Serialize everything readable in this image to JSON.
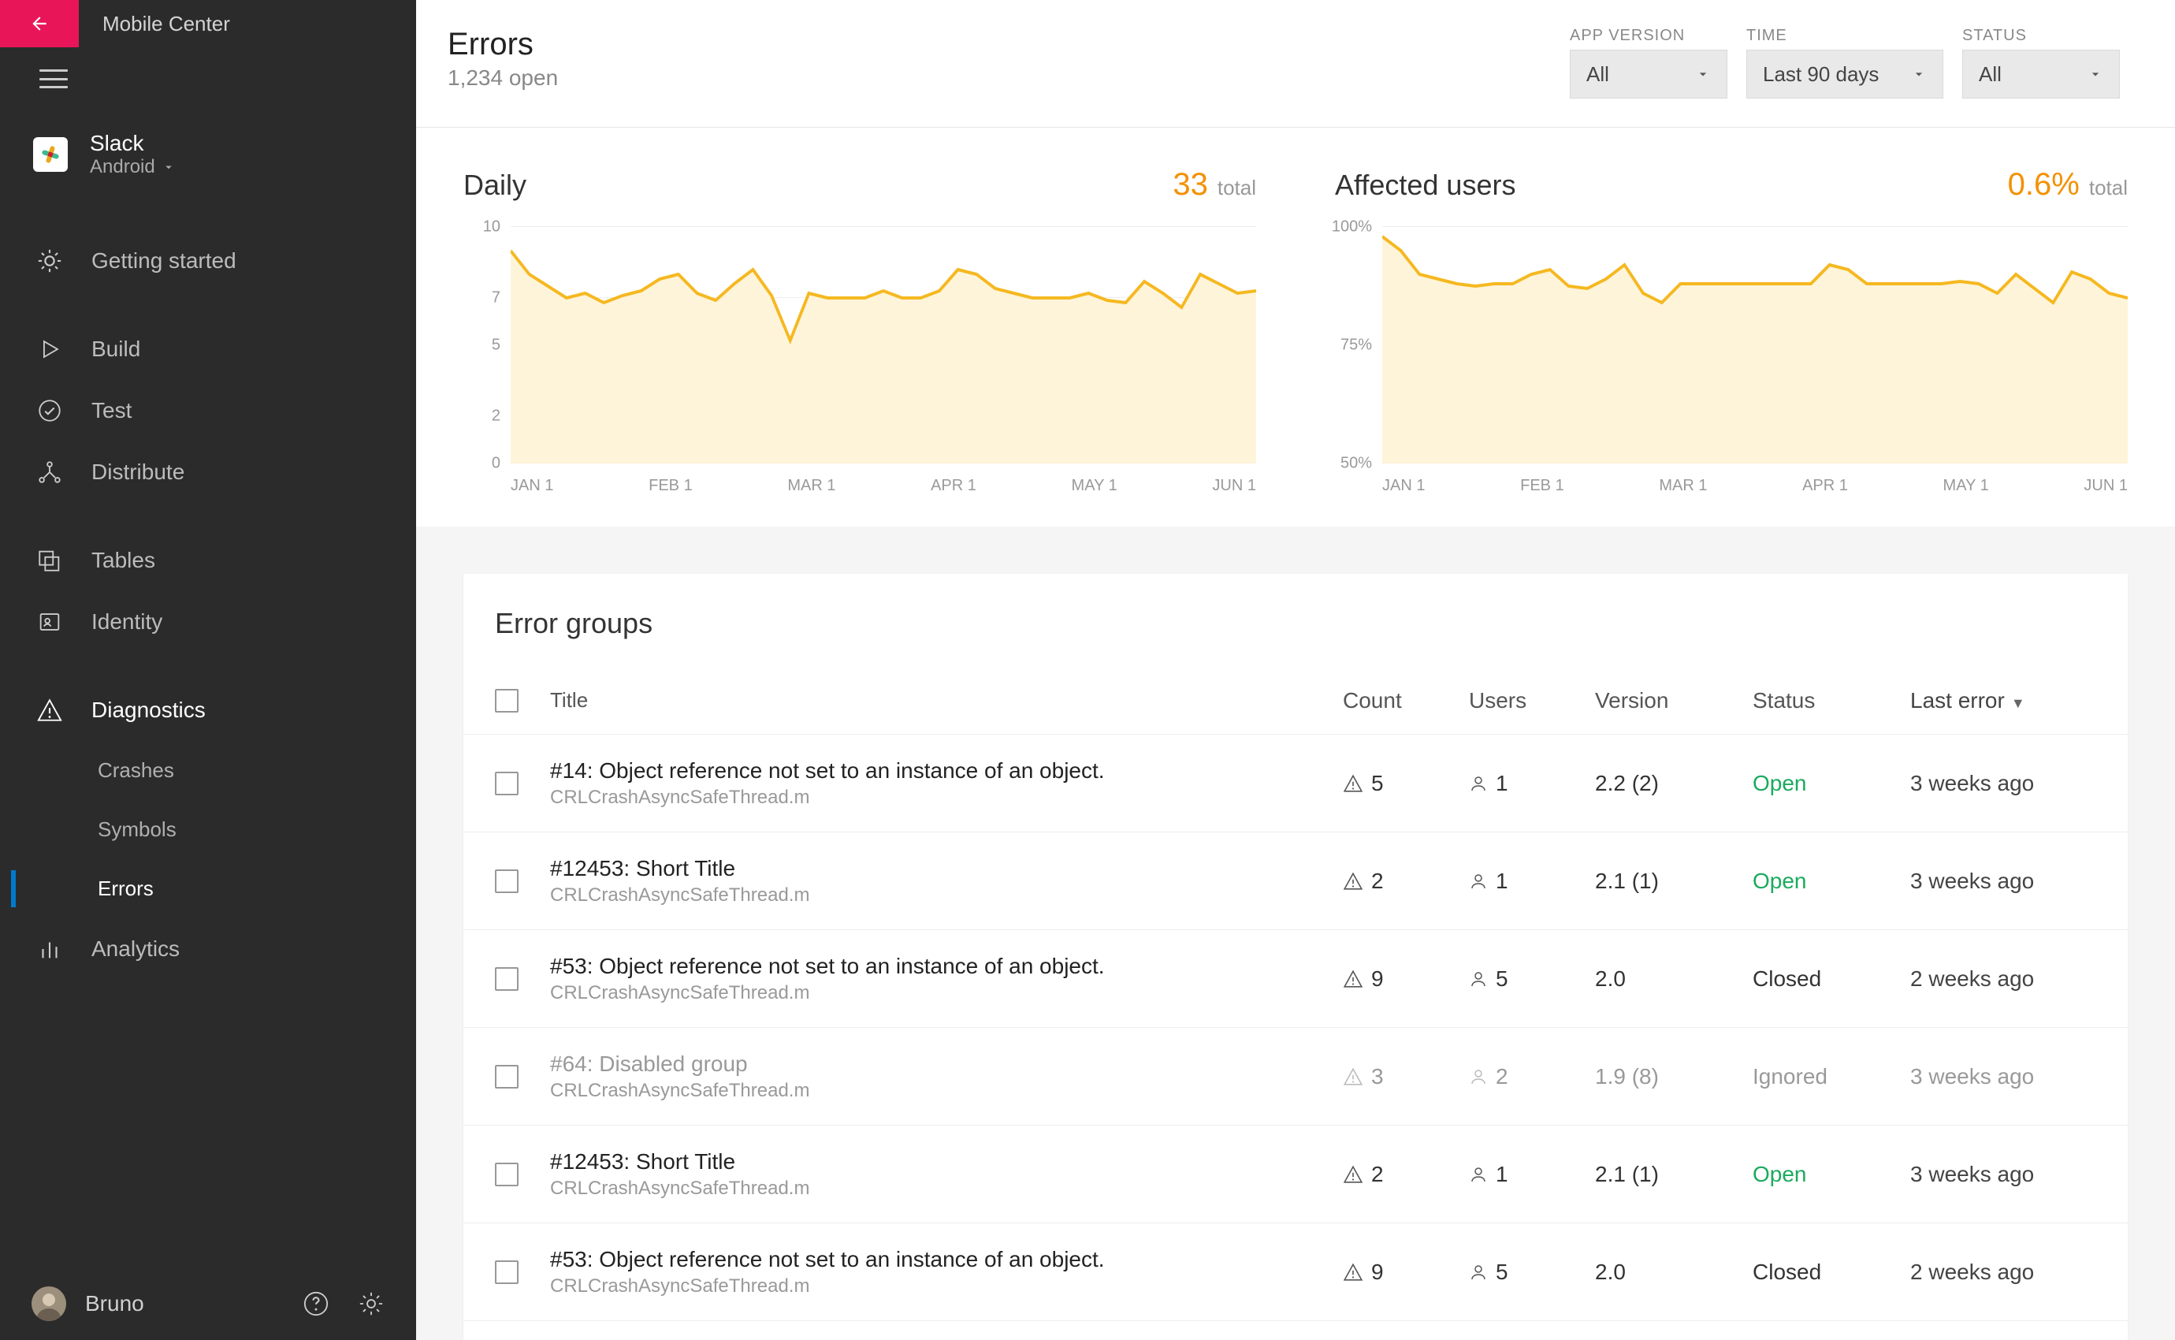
{
  "brand": "Mobile Center",
  "app": {
    "name": "Slack",
    "platform": "Android"
  },
  "sidebar": {
    "items": [
      {
        "label": "Getting started"
      },
      {
        "label": "Build"
      },
      {
        "label": "Test"
      },
      {
        "label": "Distribute"
      },
      {
        "label": "Tables"
      },
      {
        "label": "Identity"
      },
      {
        "label": "Diagnostics"
      },
      {
        "label": "Analytics"
      }
    ],
    "diag_sub": [
      {
        "label": "Crashes"
      },
      {
        "label": "Symbols"
      },
      {
        "label": "Errors"
      }
    ]
  },
  "user": {
    "name": "Bruno"
  },
  "header": {
    "title": "Errors",
    "subtitle": "1,234 open",
    "filters": {
      "version_label": "APP VERSION",
      "version_value": "All",
      "time_label": "TIME",
      "time_value": "Last 90 days",
      "status_label": "STATUS",
      "status_value": "All"
    }
  },
  "charts": {
    "daily": {
      "title": "Daily",
      "value": "33",
      "unit": "total"
    },
    "affected": {
      "title": "Affected users",
      "value": "0.6%",
      "unit": "total"
    }
  },
  "chart_data": [
    {
      "type": "line",
      "title": "Daily",
      "xlabel": "",
      "ylabel": "",
      "ylim": [
        0,
        10
      ],
      "x_ticks": [
        "JAN 1",
        "FEB 1",
        "MAR 1",
        "APR 1",
        "MAY 1",
        "JUN 1"
      ],
      "y_ticks": [
        0,
        2,
        5,
        7,
        10
      ],
      "values": [
        9,
        8,
        7.5,
        7,
        7.2,
        6.8,
        7.1,
        7.3,
        7.8,
        8,
        7.2,
        6.9,
        7.6,
        8.2,
        7.1,
        5.2,
        7.2,
        7,
        7,
        7,
        7.3,
        7,
        7,
        7.3,
        8.2,
        8,
        7.4,
        7.2,
        7,
        7,
        7,
        7.2,
        6.9,
        6.8,
        7.7,
        7.2,
        6.6,
        8,
        7.6,
        7.2,
        7.3
      ]
    },
    {
      "type": "line",
      "title": "Affected users",
      "xlabel": "",
      "ylabel": "",
      "ylim": [
        50,
        100
      ],
      "x_ticks": [
        "JAN 1",
        "FEB 1",
        "MAR 1",
        "APR 1",
        "MAY 1",
        "JUN 1"
      ],
      "y_ticks": [
        "50%",
        "75%",
        "100%"
      ],
      "values": [
        98,
        95,
        90,
        89,
        88,
        87.5,
        88,
        88,
        90,
        91,
        87.5,
        87,
        89,
        92,
        86,
        84,
        88,
        88,
        88,
        88,
        88,
        88,
        88,
        88,
        92,
        91,
        88,
        88,
        88,
        88,
        88,
        88.5,
        88,
        86,
        90,
        87,
        84,
        90.5,
        89,
        86,
        85
      ]
    }
  ],
  "groups": {
    "title": "Error groups",
    "columns": {
      "title": "Title",
      "count": "Count",
      "users": "Users",
      "version": "Version",
      "status": "Status",
      "last": "Last error"
    },
    "rows": [
      {
        "title": "#14: Object reference not set to an instance of an object.",
        "sub": "CRLCrashAsyncSafeThread.m",
        "count": "5",
        "users": "1",
        "version": "2.2 (2)",
        "status": "Open",
        "status_class": "open",
        "last": "3 weeks ago",
        "disabled": false
      },
      {
        "title": "#12453: Short Title",
        "sub": "CRLCrashAsyncSafeThread.m",
        "count": "2",
        "users": "1",
        "version": "2.1 (1)",
        "status": "Open",
        "status_class": "open",
        "last": "3 weeks ago",
        "disabled": false
      },
      {
        "title": "#53: Object reference not set to an instance of an object.",
        "sub": "CRLCrashAsyncSafeThread.m",
        "count": "9",
        "users": "5",
        "version": "2.0",
        "status": "Closed",
        "status_class": "closed",
        "last": "2 weeks ago",
        "disabled": false
      },
      {
        "title": "#64: Disabled group",
        "sub": "CRLCrashAsyncSafeThread.m",
        "count": "3",
        "users": "2",
        "version": "1.9 (8)",
        "status": "Ignored",
        "status_class": "ignored",
        "last": "3 weeks ago",
        "disabled": true
      },
      {
        "title": "#12453: Short Title",
        "sub": "CRLCrashAsyncSafeThread.m",
        "count": "2",
        "users": "1",
        "version": "2.1 (1)",
        "status": "Open",
        "status_class": "open",
        "last": "3 weeks ago",
        "disabled": false
      },
      {
        "title": "#53: Object reference not set to an instance of an object.",
        "sub": "CRLCrashAsyncSafeThread.m",
        "count": "9",
        "users": "5",
        "version": "2.0",
        "status": "Closed",
        "status_class": "closed",
        "last": "2 weeks ago",
        "disabled": false
      }
    ]
  }
}
